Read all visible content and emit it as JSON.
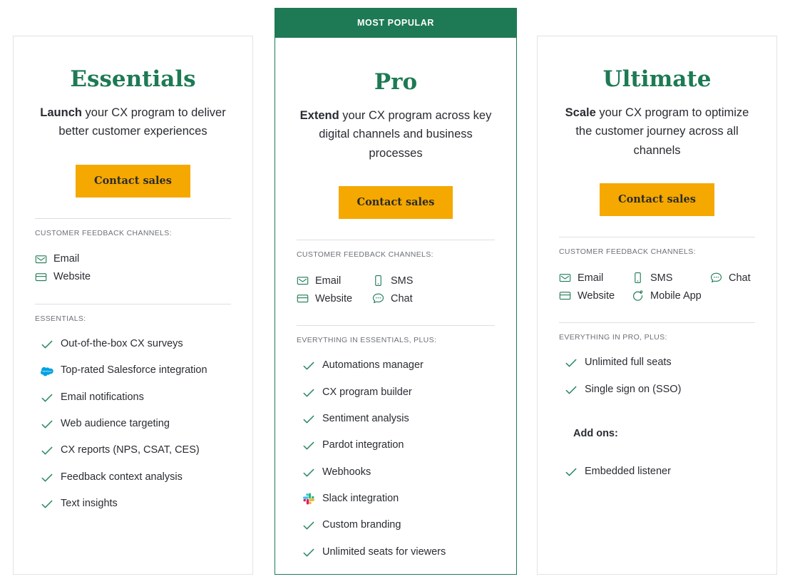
{
  "popular_banner": "MOST POPULAR",
  "cta_label": "Contact sales",
  "channels_label": "CUSTOMER FEEDBACK CHANNELS:",
  "plans": [
    {
      "name": "Essentials",
      "tagline_bold": "Launch",
      "tagline_rest": " your CX program to deliver better customer experiences",
      "cta": "Contact sales",
      "channels_label": "CUSTOMER FEEDBACK CHANNELS:",
      "channels": [
        {
          "label": "Email",
          "icon": "email-icon"
        },
        {
          "label": "Website",
          "icon": "website-icon"
        }
      ],
      "features_label": "ESSENTIALS:",
      "features": [
        {
          "label": "Out-of-the-box CX surveys",
          "icon": "check-icon"
        },
        {
          "label": "Top-rated Salesforce integration",
          "icon": "salesforce-icon"
        },
        {
          "label": "Email notifications",
          "icon": "check-icon"
        },
        {
          "label": "Web audience targeting",
          "icon": "check-icon"
        },
        {
          "label": "CX reports (NPS, CSAT, CES)",
          "icon": "check-icon"
        },
        {
          "label": "Feedback context analysis",
          "icon": "check-icon"
        },
        {
          "label": "Text insights",
          "icon": "check-icon"
        }
      ],
      "addons_heading": null,
      "addons": []
    },
    {
      "name": "Pro",
      "tagline_bold": "Extend",
      "tagline_rest": " your CX program across key digital channels and business processes",
      "cta": "Contact sales",
      "channels_label": "CUSTOMER FEEDBACK CHANNELS:",
      "channels": [
        {
          "label": "Email",
          "icon": "email-icon"
        },
        {
          "label": "Website",
          "icon": "website-icon"
        },
        {
          "label": "SMS",
          "icon": "sms-icon"
        },
        {
          "label": "Chat",
          "icon": "chat-icon"
        }
      ],
      "features_label": "EVERYTHING IN ESSENTIALS, PLUS:",
      "features": [
        {
          "label": "Automations manager",
          "icon": "check-icon"
        },
        {
          "label": "CX program builder",
          "icon": "check-icon"
        },
        {
          "label": "Sentiment analysis",
          "icon": "check-icon"
        },
        {
          "label": "Pardot integration",
          "icon": "check-icon"
        },
        {
          "label": "Webhooks",
          "icon": "check-icon"
        },
        {
          "label": "Slack integration",
          "icon": "slack-icon"
        },
        {
          "label": "Custom branding",
          "icon": "check-icon"
        },
        {
          "label": "Unlimited seats for viewers",
          "icon": "check-icon"
        }
      ],
      "addons_heading": null,
      "addons": []
    },
    {
      "name": "Ultimate",
      "tagline_bold": "Scale",
      "tagline_rest": " your CX program to optimize the customer journey across all channels",
      "cta": "Contact sales",
      "channels_label": "CUSTOMER FEEDBACK CHANNELS:",
      "channels": [
        {
          "label": "Email",
          "icon": "email-icon"
        },
        {
          "label": "Website",
          "icon": "website-icon"
        },
        {
          "label": "SMS",
          "icon": "sms-icon"
        },
        {
          "label": "Mobile App",
          "icon": "mobile-app-icon"
        },
        {
          "label": "Chat",
          "icon": "chat-icon"
        }
      ],
      "features_label": "EVERYTHING IN PRO, PLUS:",
      "features": [
        {
          "label": "Unlimited full seats",
          "icon": "check-icon"
        },
        {
          "label": "Single sign on (SSO)",
          "icon": "check-icon"
        }
      ],
      "addons_heading": "Add ons:",
      "addons": [
        {
          "label": "Embedded listener",
          "icon": "check-icon"
        }
      ]
    }
  ],
  "colors": {
    "brand_green": "#1e7a54",
    "check_green": "#2e8b63",
    "cta_amber": "#f5a800",
    "card_border": "#e2e3e6",
    "text": "#2a2c33",
    "muted_label": "#6d7078",
    "salesforce_blue": "#00a1e0"
  }
}
